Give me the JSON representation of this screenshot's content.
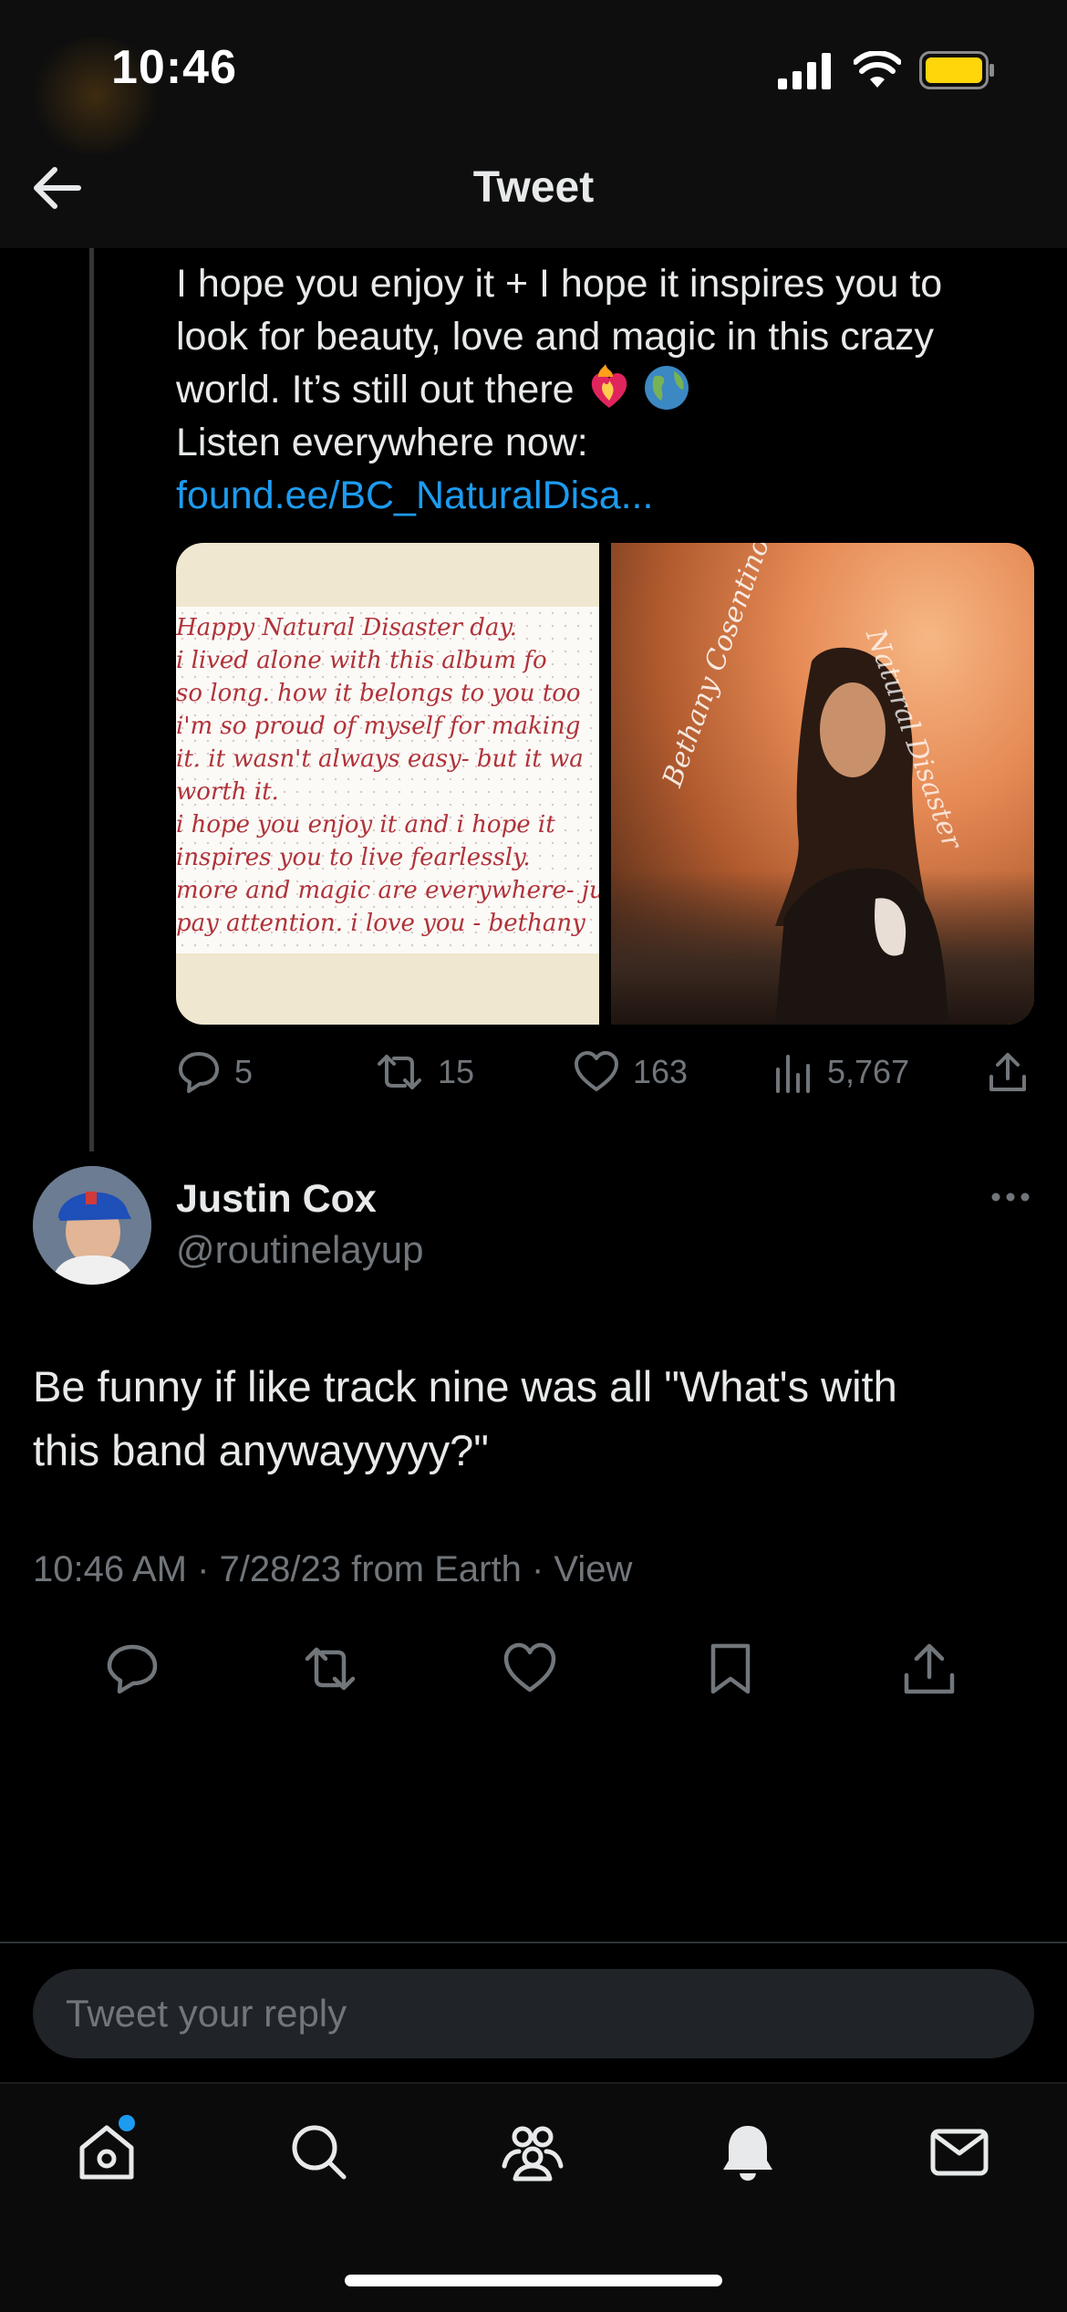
{
  "status_bar": {
    "time": "10:46"
  },
  "header": {
    "title": "Tweet"
  },
  "previous_tweet": {
    "lines": [
      "I hope you enjoy it + I hope it inspires you to",
      "look for beauty, love and magic in this crazy",
      "world. It’s still out there",
      "Listen everywhere now:"
    ],
    "link": "found.ee/BC_NaturalDisa...",
    "emojis": [
      "heart-on-fire-icon",
      "globe-icon"
    ],
    "note_lines": [
      "Happy Natural Disaster day.",
      "i lived alone with this album fo",
      "so long. how it belongs to you too",
      "i'm so proud of myself for making",
      "it. it wasn't always easy- but it wa",
      "worth it.",
      "i hope you enjoy it and i hope it",
      "inspires you to live fearlessly.",
      "more and magic are everywhere- just",
      "pay attention. i love you - bethany"
    ],
    "cover_texts": [
      "Bethany Cosentino",
      "Natural Disaster"
    ],
    "stats": {
      "replies": "5",
      "retweets": "15",
      "likes": "163",
      "views": "5,767"
    }
  },
  "tweet": {
    "author_name": "Justin Cox",
    "author_handle": "@routinelayup",
    "text_lines": [
      "Be funny if like track nine was all \"What's with",
      "this band anywayyyyy?\""
    ],
    "meta": "10:46 AM · 7/28/23 from Earth · ",
    "view_link": "View"
  },
  "reply": {
    "placeholder": "Tweet your reply"
  },
  "tabs": [
    "home-icon",
    "search-icon",
    "communities-icon",
    "notifications-icon",
    "messages-icon"
  ],
  "colors": {
    "accent": "#1d9bf0",
    "muted": "#71767b",
    "text": "#e7e9ea",
    "background": "#000000"
  }
}
